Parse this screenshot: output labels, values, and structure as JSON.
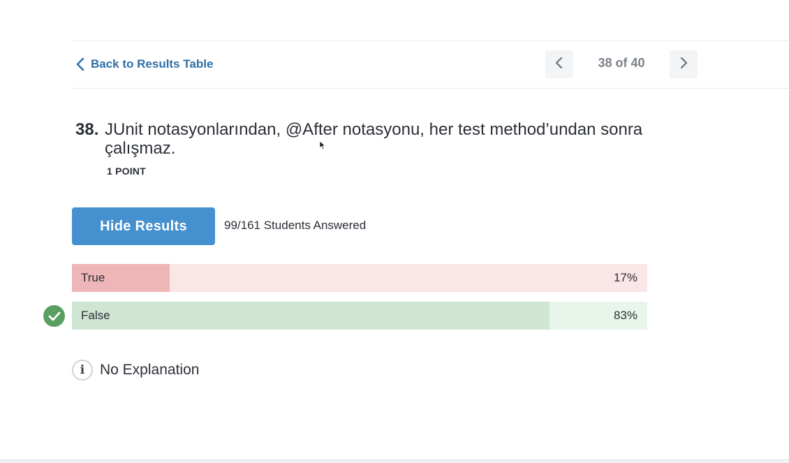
{
  "navigation": {
    "back_label": "Back to Results Table",
    "pager_label": "38 of 40"
  },
  "question": {
    "number": "38.",
    "text": "JUnit notasyonlarından, @After notasyonu, her test method’undan sonra çalışmaz.",
    "points": "1 POINT"
  },
  "results": {
    "hide_button_label": "Hide Results",
    "answered_text": "99/161 Students Answered",
    "answers": [
      {
        "label": "True",
        "percent_text": "17%",
        "percent": 17,
        "correct": false
      },
      {
        "label": "False",
        "percent_text": "83%",
        "percent": 83,
        "correct": true
      }
    ]
  },
  "explanation": {
    "info_glyph": "i",
    "text": "No Explanation"
  },
  "colors": {
    "accent_blue": "#4590cf",
    "link_blue": "#2f6fa7",
    "incorrect_fill": "#efb6b8",
    "incorrect_track": "#fbe6e7",
    "correct_fill": "#cfe6d3",
    "correct_track": "#e8f5ea",
    "correct_icon": "#5a9e62"
  },
  "icons": {
    "back": "chevron-left-icon",
    "prev": "chevron-left-icon",
    "next": "chevron-right-icon",
    "correct": "check-circle-icon",
    "info": "info-icon"
  }
}
